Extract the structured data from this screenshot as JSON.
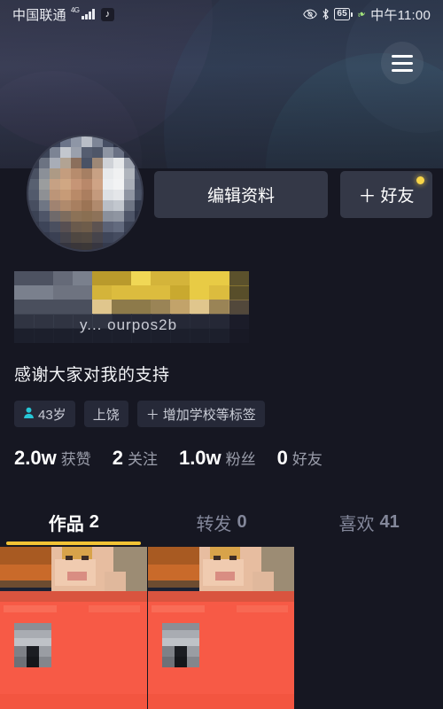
{
  "statusbar": {
    "carrier": "中国联通",
    "network": "4G",
    "app_badge_icon": "douyin-note-icon",
    "eye_icon": "eye-protection-icon",
    "bluetooth_icon": "bluetooth-icon",
    "battery_level": "65",
    "leaf_icon": "power-saving-leaf-icon",
    "time": "中午11:00"
  },
  "header": {
    "menu_icon": "hamburger-menu-icon"
  },
  "profile": {
    "avatar_alt": "censored-avatar",
    "name_censored": true,
    "uid_text": "y... ourpos2b",
    "signature": "感谢大家对我的支持",
    "edit_button": "编辑资料",
    "friend_button": "好友",
    "friend_button_plus": "＋",
    "has_friend_badge": true
  },
  "chips": [
    {
      "icon": "person-icon",
      "label": "43岁"
    },
    {
      "icon": "",
      "label": "上饶"
    },
    {
      "icon": "plus-icon",
      "label": "增加学校等标签"
    }
  ],
  "stats": [
    {
      "num": "2.0w",
      "label": "获赞"
    },
    {
      "num": "2",
      "label": "关注"
    },
    {
      "num": "1.0w",
      "label": "粉丝"
    },
    {
      "num": "0",
      "label": "好友"
    }
  ],
  "tabs": [
    {
      "label": "作品",
      "count": "2",
      "active": true
    },
    {
      "label": "转发",
      "count": "0",
      "active": false
    },
    {
      "label": "喜欢",
      "count": "41",
      "active": false
    }
  ],
  "posts": [
    {
      "type": "video-thumbnail",
      "censored": true
    },
    {
      "type": "video-thumbnail",
      "censored": true
    },
    {
      "type": "empty",
      "censored": false
    }
  ],
  "colors": {
    "background": "#161722",
    "banner": "#343c52",
    "accent_yellow": "#f2c335",
    "button": "#343847",
    "chip": "#262938",
    "muted_text": "#9a9daa",
    "badge_dot": "#f8d548",
    "red_band": "#f75a46",
    "person_icon": "#26c6d6"
  }
}
